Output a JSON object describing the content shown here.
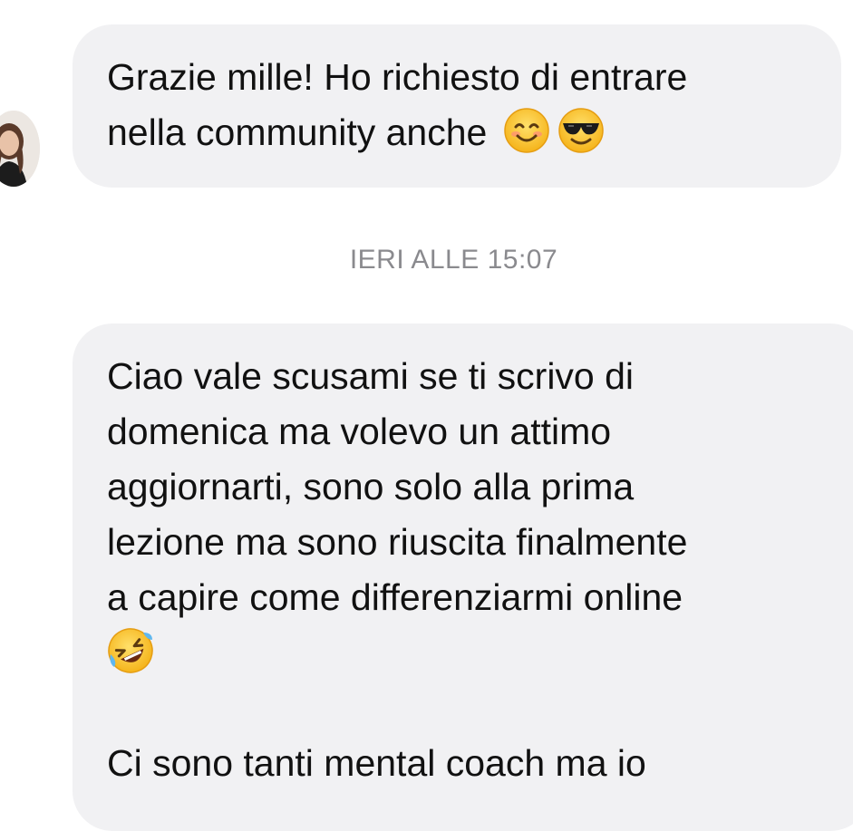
{
  "conversation": {
    "messages": [
      {
        "sender": "contact",
        "lines": [
          "Grazie mille! Ho richiesto di entrare",
          "nella community anche"
        ],
        "emojis": [
          "smiling-face-icon",
          "sunglasses-face-icon"
        ]
      },
      {
        "sender": "contact",
        "lines": [
          "Ciao vale scusami se ti scrivo di",
          "domenica ma volevo un attimo",
          "aggiornarti, sono solo alla prima",
          "lezione ma sono riuscita finalmente",
          "a capire come differenziarmi online",
          "",
          "Ci sono tanti mental coach ma io"
        ],
        "emojis": [
          "rolling-laughing-face-icon"
        ]
      }
    ],
    "timestamp": "IERI ALLE 15:07"
  },
  "colors": {
    "bubble_bg": "#f1f1f3",
    "timestamp_text": "#8a8a8e",
    "emoji_yellow": "#fcc21b"
  }
}
